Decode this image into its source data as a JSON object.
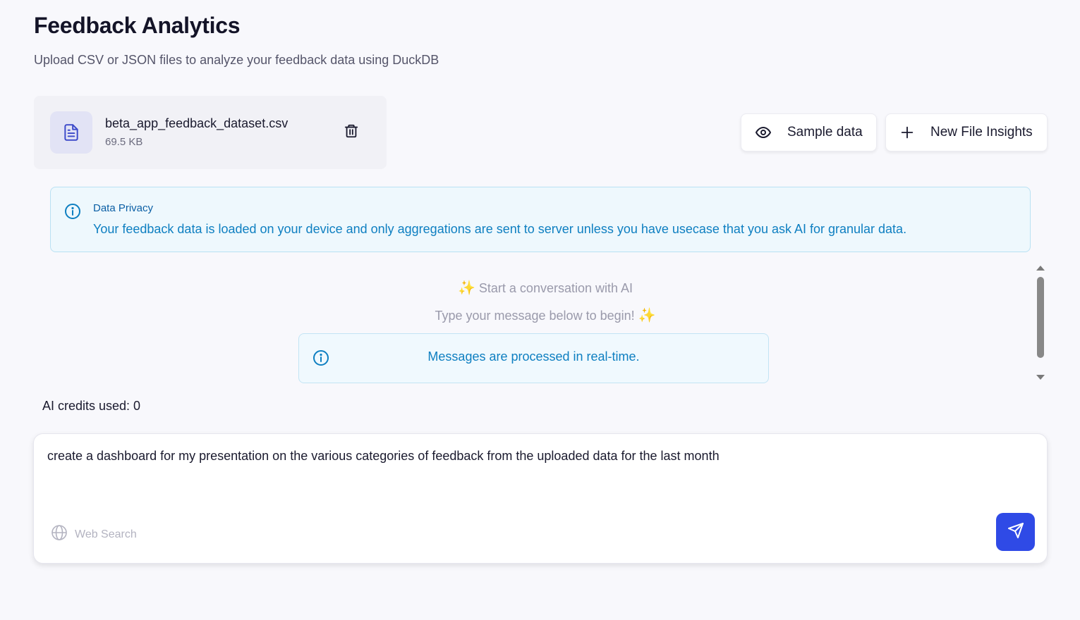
{
  "page": {
    "title": "Feedback Analytics",
    "subtitle": "Upload CSV or JSON files to analyze your feedback data using DuckDB"
  },
  "file": {
    "name": "beta_app_feedback_dataset.csv",
    "size": "69.5 KB",
    "icon": "file-text-icon",
    "delete_icon": "trash-icon"
  },
  "actions": {
    "sample_label": "Sample data",
    "sample_icon": "eye-icon",
    "new_file_label": "New File Insights",
    "new_file_icon": "plus-icon"
  },
  "privacy": {
    "title": "Data Privacy",
    "text": "Your feedback data is loaded on your device and only aggregations are sent to server unless you have usecase that you ask AI for granular data.",
    "icon": "info-icon"
  },
  "chat": {
    "start_text": "Start a conversation with AI",
    "begin_text": "Type your message below to begin!",
    "sparkle": "✨",
    "realtime_text": "Messages are processed in real-time."
  },
  "credits": {
    "text": "AI credits used: 0"
  },
  "composer": {
    "message": "create a dashboard for my presentation on the various categories of feedback from the uploaded data for the last month",
    "web_search_label": "Web Search",
    "web_search_icon": "globe-icon",
    "send_icon": "send-icon"
  },
  "colors": {
    "accent": "#2f4ae6",
    "info_text": "#0e7fc1",
    "info_bg": "#eef8fd",
    "page_bg": "#f8f8fc"
  }
}
